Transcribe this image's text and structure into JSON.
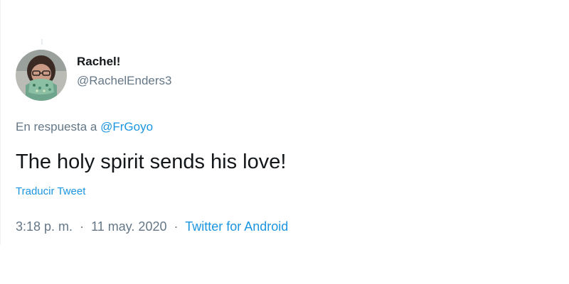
{
  "author": {
    "display_name": "Rachel!",
    "handle": "@RachelEnders3"
  },
  "reply": {
    "prefix": "En respuesta a",
    "mention": "@FrGoyo"
  },
  "tweet": {
    "text": "The holy spirit sends his love!",
    "translate_label": "Traducir Tweet"
  },
  "meta": {
    "time": "3:18 p. m.",
    "separator": "·",
    "date": "11 may. 2020",
    "source": "Twitter for Android"
  },
  "colors": {
    "text": "#14171a",
    "secondary": "#657786",
    "link": "#1b95e0"
  }
}
